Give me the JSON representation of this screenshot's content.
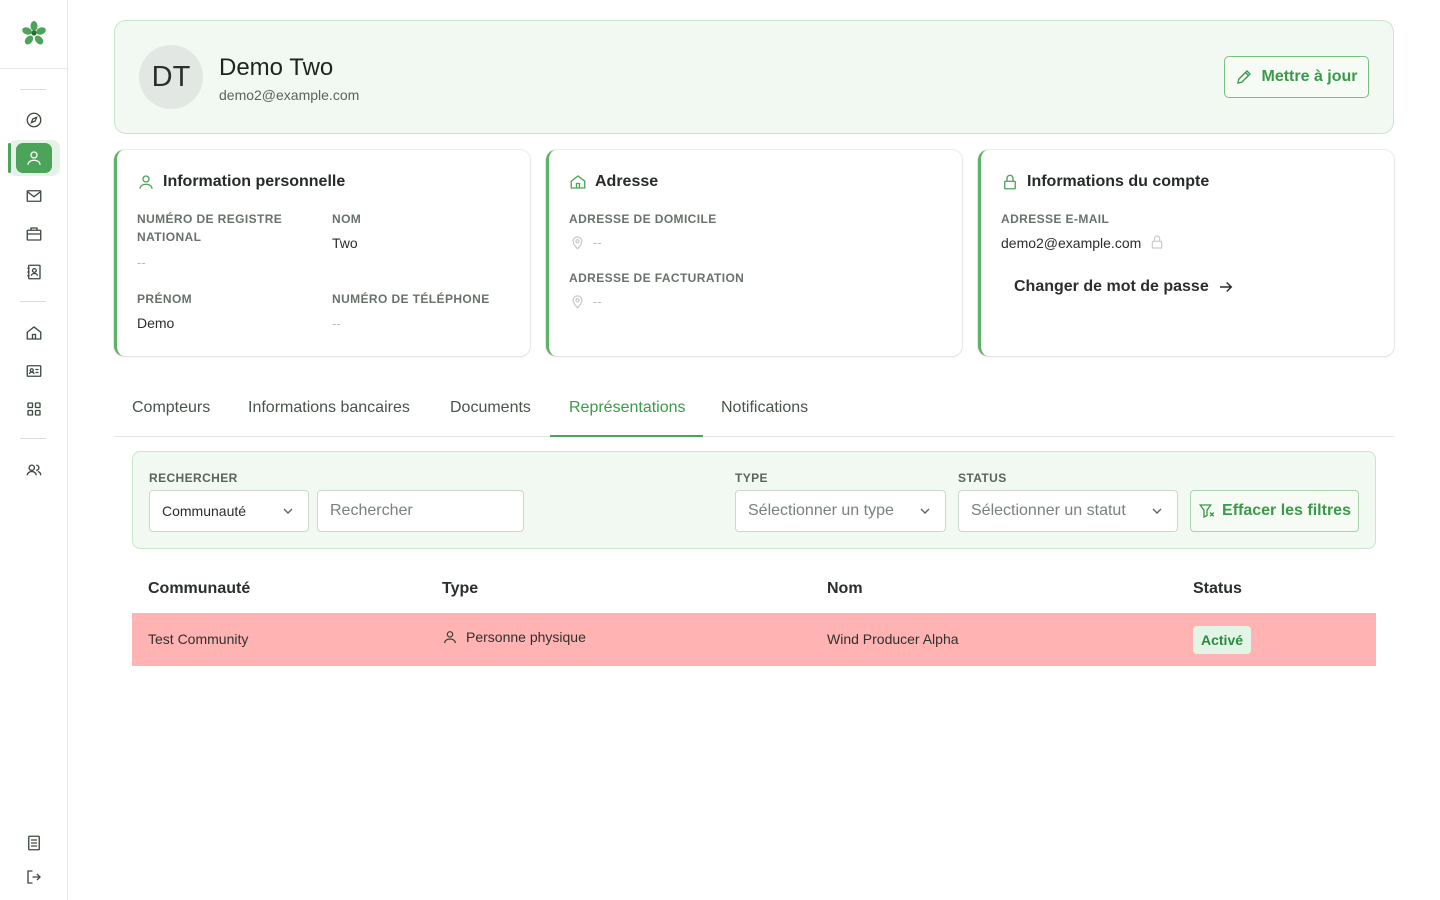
{
  "sidebar": {
    "items": [
      {
        "icon": "compass-icon"
      },
      {
        "icon": "user-icon",
        "active": true
      },
      {
        "icon": "mail-icon"
      },
      {
        "icon": "briefcase-icon"
      },
      {
        "icon": "contact-book-icon"
      },
      {
        "icon": "home-icon"
      },
      {
        "icon": "id-card-icon"
      },
      {
        "icon": "grid-icon"
      },
      {
        "icon": "users-icon"
      }
    ],
    "bottom": [
      {
        "icon": "document-icon"
      },
      {
        "icon": "logout-icon"
      }
    ]
  },
  "profile": {
    "initials": "DT",
    "name": "Demo Two",
    "email": "demo2@example.com",
    "update_label": "Mettre à jour"
  },
  "personal": {
    "title": "Information personnelle",
    "registry_label": "Numéro de registre national",
    "registry_value": "--",
    "last_name_label": "Nom",
    "last_name_value": "Two",
    "first_name_label": "Prénom",
    "first_name_value": "Demo",
    "phone_label": "Numéro de téléphone",
    "phone_value": "--"
  },
  "address": {
    "title": "Adresse",
    "home_label": "Adresse de domicile",
    "home_value": "--",
    "billing_label": "Adresse de facturation",
    "billing_value": "--"
  },
  "account": {
    "title": "Informations du compte",
    "email_label": "Adresse e-mail",
    "email_value": "demo2@example.com",
    "change_password_label": "Changer de mot de passe"
  },
  "tabs": [
    {
      "label": "Compteurs"
    },
    {
      "label": "Informations bancaires"
    },
    {
      "label": "Documents"
    },
    {
      "label": "Représentations",
      "active": true
    },
    {
      "label": "Notifications"
    }
  ],
  "filters": {
    "search_label": "RECHERCHER",
    "scope_value": "Communauté",
    "search_placeholder": "Rechercher",
    "type_label": "TYPE",
    "type_placeholder": "Sélectionner un type",
    "status_label": "STATUS",
    "status_placeholder": "Sélectionner un statut",
    "clear_label": "Effacer les filtres"
  },
  "table": {
    "columns": [
      "Communauté",
      "Type",
      "Nom",
      "Status"
    ],
    "rows": [
      {
        "community": "Test Community",
        "type": "Personne physique",
        "name": "Wind Producer Alpha",
        "status": "Activé"
      }
    ]
  },
  "colors": {
    "accent": "#4ca35a",
    "row_highlight": "#ffb3b3",
    "panel_bg": "#f2f9f2"
  }
}
